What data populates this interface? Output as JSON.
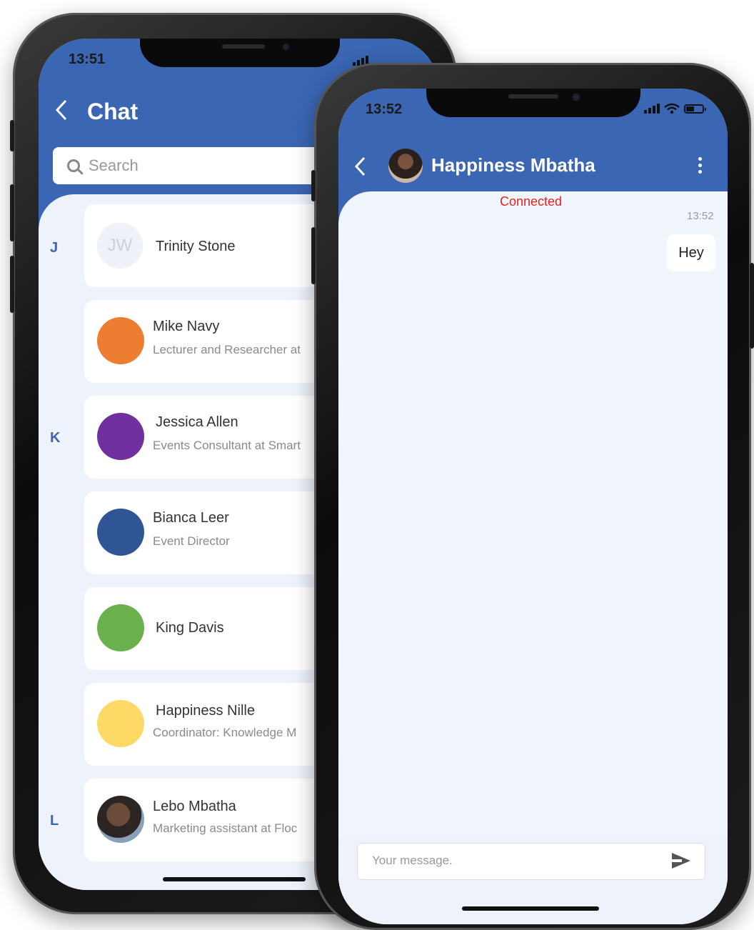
{
  "left_phone": {
    "status": {
      "time": "13:51"
    },
    "header": {
      "title": "Chat",
      "back_icon": "chevron-left-icon"
    },
    "search": {
      "placeholder": "Search",
      "icon": "search-icon"
    },
    "sections": [
      "J",
      "K",
      "L"
    ],
    "contacts": [
      {
        "initials": "JW",
        "name": "Trinity Stone",
        "subtitle": "",
        "color": "#eef1f7"
      },
      {
        "name": "Mike Navy",
        "subtitle": "Lecturer and Researcher at",
        "color": "#ed7d31"
      },
      {
        "name": "Jessica Allen",
        "subtitle": "Events Consultant at Smart",
        "color": "#7030a0"
      },
      {
        "name": "Bianca Leer",
        "subtitle": "Event Director",
        "color": "#2f5597"
      },
      {
        "name": "King Davis",
        "subtitle": "",
        "color": "#6ab04c"
      },
      {
        "name": "Happiness Nille",
        "subtitle": "Coordinator: Knowledge M",
        "color": "#ffd966"
      },
      {
        "name": "Lebo Mbatha",
        "subtitle": "Marketing assistant  at Floc",
        "color": "#4a3b32"
      }
    ]
  },
  "right_phone": {
    "status": {
      "time": "13:52"
    },
    "header": {
      "contact_name": "Happiness Mbatha",
      "back_icon": "chevron-left-icon",
      "menu_icon": "more-vertical-icon"
    },
    "connection_status": "Connected",
    "messages": [
      {
        "time": "13:52",
        "text": "Hey"
      }
    ],
    "composer": {
      "placeholder": "Your message.",
      "send_icon": "send-icon"
    }
  },
  "colors": {
    "primary": "#3a66b3",
    "connected": "#e02424",
    "background": "#eef2fa"
  }
}
